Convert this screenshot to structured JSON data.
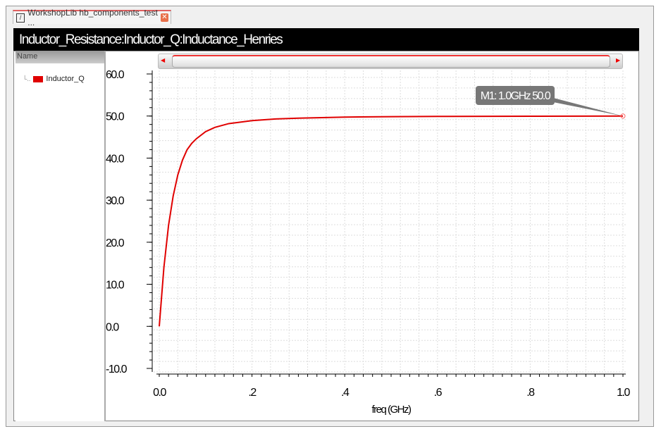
{
  "tab": {
    "title": "WorkshopLib hb_components_test ..."
  },
  "window_title": "Inductor_Resistance:Inductor_Q:Inductance_Henries",
  "sidebar": {
    "header": "Name",
    "items": [
      {
        "label": "Inductor_Q",
        "color": "#e00000"
      }
    ]
  },
  "marker": {
    "label": "M1: 1.0GHz 50.0",
    "x": 1.0,
    "y": 50.0
  },
  "chart_data": {
    "type": "line",
    "title": "Inductor_Resistance:Inductor_Q:Inductance_Henries",
    "xlabel": "freq (GHz)",
    "ylabel": "",
    "xlim": [
      0,
      1.0
    ],
    "ylim": [
      -10,
      60
    ],
    "xticks": [
      {
        "v": 0,
        "label": "0.0"
      },
      {
        "v": 0.2,
        "label": ".2"
      },
      {
        "v": 0.4,
        "label": ".4"
      },
      {
        "v": 0.6,
        "label": ".6"
      },
      {
        "v": 0.8,
        "label": ".8"
      },
      {
        "v": 1.0,
        "label": "1.0"
      }
    ],
    "yticks": [
      {
        "v": 60,
        "label": "60.0"
      },
      {
        "v": 50,
        "label": "50.0"
      },
      {
        "v": 40,
        "label": "40.0"
      },
      {
        "v": 30,
        "label": "30.0"
      },
      {
        "v": 20,
        "label": "20.0"
      },
      {
        "v": 10,
        "label": "10.0"
      },
      {
        "v": 0,
        "label": "0.0"
      },
      {
        "v": -10,
        "label": "-10.0"
      }
    ],
    "grid": true,
    "series": [
      {
        "name": "Inductor_Q",
        "color": "#e00000",
        "x": [
          0,
          0.01,
          0.02,
          0.03,
          0.04,
          0.05,
          0.06,
          0.07,
          0.08,
          0.1,
          0.12,
          0.15,
          0.2,
          0.25,
          0.3,
          0.4,
          0.5,
          0.6,
          0.8,
          1.0
        ],
        "y": [
          0,
          14,
          24,
          31,
          36,
          39.5,
          42,
          43.5,
          44.6,
          46.3,
          47.3,
          48.2,
          48.9,
          49.3,
          49.5,
          49.75,
          49.85,
          49.9,
          49.95,
          50.0
        ]
      }
    ]
  }
}
